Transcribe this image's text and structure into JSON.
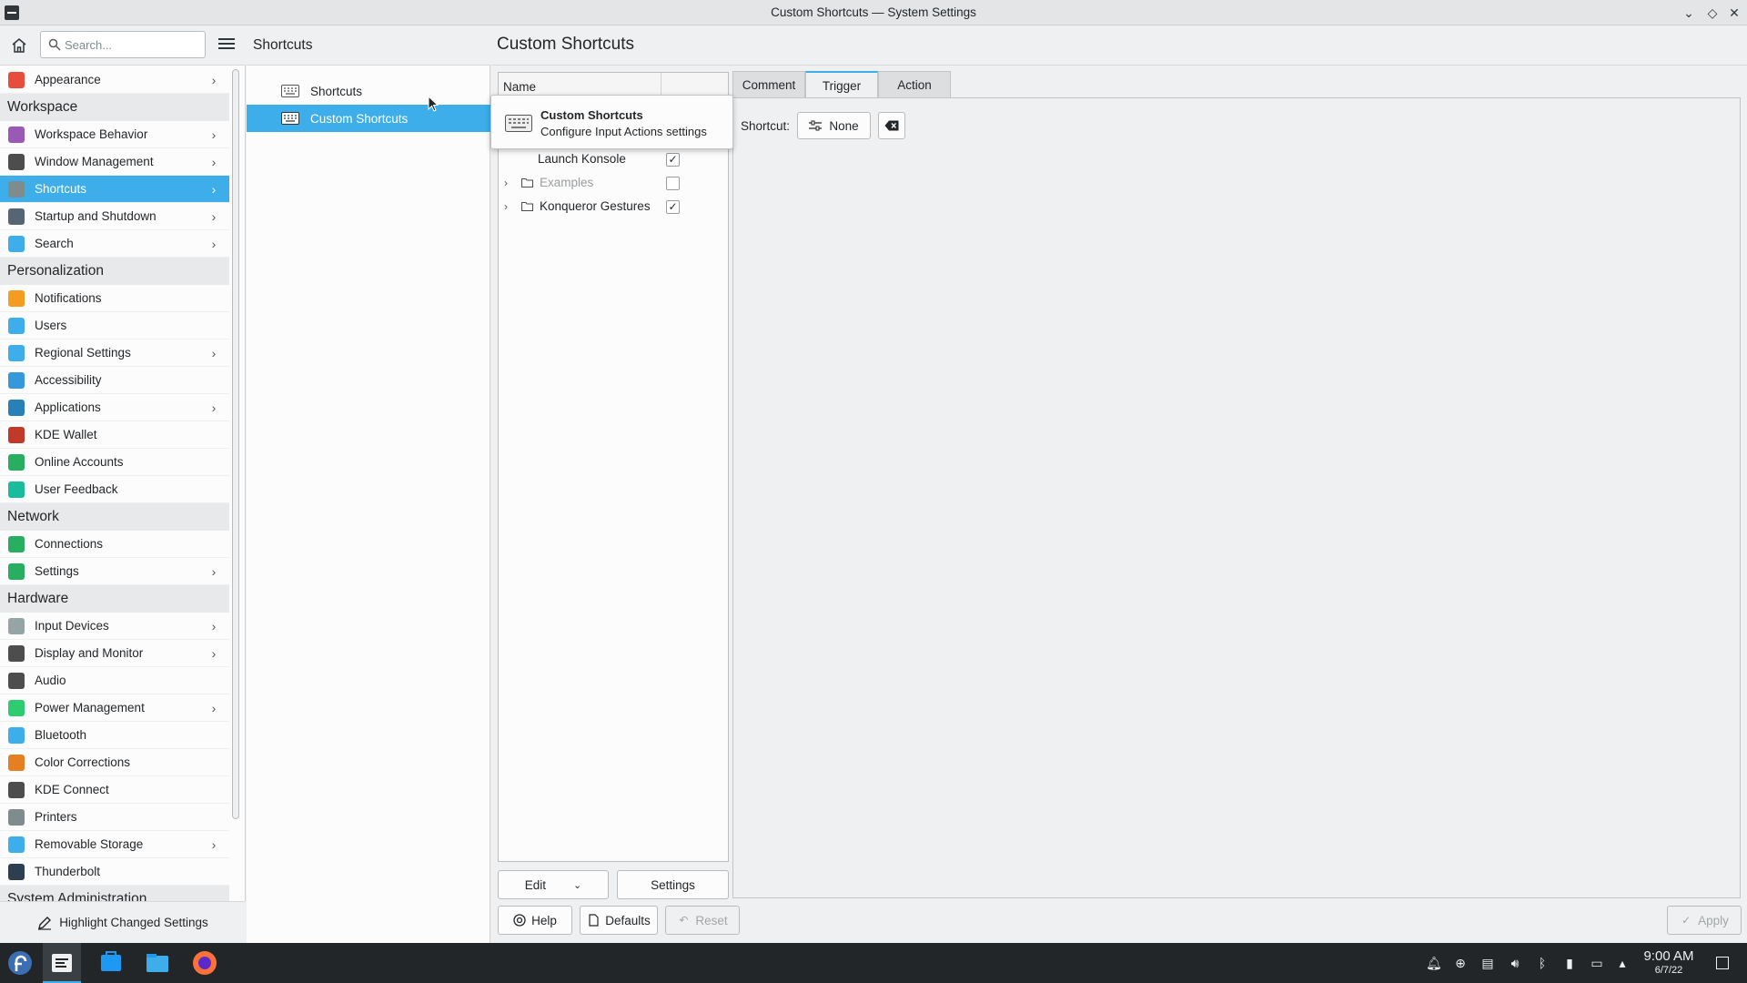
{
  "window": {
    "title": "Custom Shortcuts — System Settings",
    "buttons": {
      "minimize": "⌄",
      "maximize": "◇",
      "close": "✕"
    }
  },
  "sidebar": {
    "search_placeholder": "Search...",
    "items": [
      {
        "label": "Appearance",
        "icon": "appearance-icon",
        "color": "#e74c3c",
        "chevron": true,
        "type": "item"
      },
      {
        "label": "Workspace",
        "type": "section"
      },
      {
        "label": "Workspace Behavior",
        "icon": "workspace-behavior-icon",
        "color": "#9b59b6",
        "chevron": true,
        "type": "item"
      },
      {
        "label": "Window Management",
        "icon": "window-management-icon",
        "color": "#4d4d4d",
        "chevron": true,
        "type": "item"
      },
      {
        "label": "Shortcuts",
        "icon": "keyboard-icon",
        "color": "#7f8c8d",
        "chevron": true,
        "type": "item",
        "selected": true
      },
      {
        "label": "Startup and Shutdown",
        "icon": "startup-shutdown-icon",
        "color": "#566573",
        "chevron": true,
        "type": "item"
      },
      {
        "label": "Search",
        "icon": "search-settings-icon",
        "color": "#3daee9",
        "chevron": true,
        "type": "item"
      },
      {
        "label": "Personalization",
        "type": "section"
      },
      {
        "label": "Notifications",
        "icon": "bell-icon",
        "color": "#f39c1f",
        "chevron": false,
        "type": "item"
      },
      {
        "label": "Users",
        "icon": "users-icon",
        "color": "#3daee9",
        "chevron": false,
        "type": "item"
      },
      {
        "label": "Regional Settings",
        "icon": "regional-settings-icon",
        "color": "#3daee9",
        "chevron": true,
        "type": "item"
      },
      {
        "label": "Accessibility",
        "icon": "accessibility-icon",
        "color": "#3498db",
        "chevron": false,
        "type": "item"
      },
      {
        "label": "Applications",
        "icon": "applications-icon",
        "color": "#2980b9",
        "chevron": true,
        "type": "item"
      },
      {
        "label": "KDE Wallet",
        "icon": "wallet-icon",
        "color": "#c0392b",
        "chevron": false,
        "type": "item"
      },
      {
        "label": "Online Accounts",
        "icon": "online-accounts-icon",
        "color": "#27ae60",
        "chevron": false,
        "type": "item"
      },
      {
        "label": "User Feedback",
        "icon": "user-feedback-icon",
        "color": "#1abc9c",
        "chevron": false,
        "type": "item"
      },
      {
        "label": "Network",
        "type": "section"
      },
      {
        "label": "Connections",
        "icon": "connections-icon",
        "color": "#27ae60",
        "chevron": false,
        "type": "item"
      },
      {
        "label": "Settings",
        "icon": "network-settings-icon",
        "color": "#27ae60",
        "chevron": true,
        "type": "item"
      },
      {
        "label": "Hardware",
        "type": "section"
      },
      {
        "label": "Input Devices",
        "icon": "mouse-icon",
        "color": "#95a5a6",
        "chevron": true,
        "type": "item"
      },
      {
        "label": "Display and Monitor",
        "icon": "monitor-icon",
        "color": "#4d4d4d",
        "chevron": true,
        "type": "item"
      },
      {
        "label": "Audio",
        "icon": "audio-icon",
        "color": "#4d4d4d",
        "chevron": false,
        "type": "item"
      },
      {
        "label": "Power Management",
        "icon": "power-icon",
        "color": "#2ecc71",
        "chevron": true,
        "type": "item"
      },
      {
        "label": "Bluetooth",
        "icon": "bluetooth-icon",
        "color": "#3daee9",
        "chevron": false,
        "type": "item"
      },
      {
        "label": "Color Corrections",
        "icon": "color-corrections-icon",
        "color": "#e67e22",
        "chevron": false,
        "type": "item"
      },
      {
        "label": "KDE Connect",
        "icon": "kde-connect-icon",
        "color": "#4d4d4d",
        "chevron": false,
        "type": "item"
      },
      {
        "label": "Printers",
        "icon": "printer-icon",
        "color": "#7f8c8d",
        "chevron": false,
        "type": "item"
      },
      {
        "label": "Removable Storage",
        "icon": "removable-storage-icon",
        "color": "#3daee9",
        "chevron": true,
        "type": "item"
      },
      {
        "label": "Thunderbolt",
        "icon": "thunderbolt-icon",
        "color": "#2c3e50",
        "chevron": false,
        "type": "item"
      },
      {
        "label": "System Administration",
        "type": "section"
      }
    ],
    "highlight_label": "Highlight Changed Settings"
  },
  "midcol": {
    "title": "Shortcuts",
    "items": [
      {
        "label": "Shortcuts"
      },
      {
        "label": "Custom Shortcuts"
      }
    ]
  },
  "content": {
    "title": "Custom Shortcuts",
    "tree": {
      "column_name": "Name",
      "rows": [
        {
          "label": "Launch Konsole",
          "checked": true,
          "folder": false,
          "arrow": false,
          "dim": false
        },
        {
          "label": "Examples",
          "checked": false,
          "folder": true,
          "arrow": true,
          "dim": true
        },
        {
          "label": "Konqueror Gestures",
          "checked": true,
          "folder": true,
          "arrow": true,
          "dim": false
        }
      ]
    },
    "tooltip": {
      "title": "Custom Shortcuts",
      "subtitle": "Configure Input Actions settings"
    },
    "tabs": [
      "Comment",
      "Trigger",
      "Action"
    ],
    "active_tab": "Trigger",
    "shortcut_label": "Shortcut:",
    "shortcut_value": "None",
    "edit_label": "Edit",
    "settings_label": "Settings",
    "footer": {
      "help": "Help",
      "defaults": "Defaults",
      "reset": "Reset",
      "apply": "Apply"
    }
  },
  "taskbar": {
    "time": "9:00 AM",
    "date": "6/7/22"
  },
  "colors": {
    "accent": "#3daee9",
    "taskbar": "#232629"
  }
}
